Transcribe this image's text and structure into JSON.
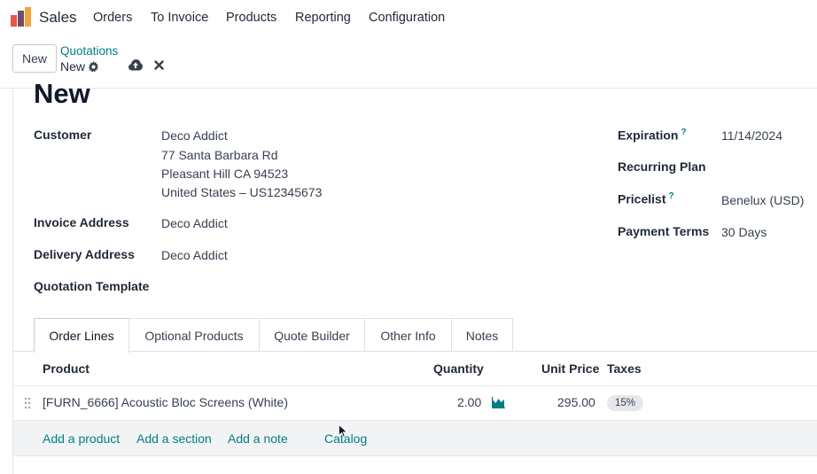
{
  "navbar": {
    "app_name": "Sales",
    "menu": [
      "Orders",
      "To Invoice",
      "Products",
      "Reporting",
      "Configuration"
    ]
  },
  "control_panel": {
    "new_button": "New",
    "breadcrumb_parent": "Quotations",
    "breadcrumb_current": "New"
  },
  "form": {
    "title": "New",
    "customer": {
      "label": "Customer",
      "name": "Deco Addict",
      "street": "77 Santa Barbara Rd",
      "city": "Pleasant Hill CA 94523",
      "country": "United States – US12345673"
    },
    "invoice_address": {
      "label": "Invoice Address",
      "value": "Deco Addict"
    },
    "delivery_address": {
      "label": "Delivery Address",
      "value": "Deco Addict"
    },
    "quotation_template": {
      "label": "Quotation Template",
      "value": ""
    },
    "expiration": {
      "label": "Expiration",
      "help": "?",
      "value": "11/14/2024"
    },
    "recurring_plan": {
      "label": "Recurring Plan",
      "value": ""
    },
    "pricelist": {
      "label": "Pricelist",
      "help": "?",
      "value": "Benelux (USD)"
    },
    "payment_terms": {
      "label": "Payment Terms",
      "value": "30 Days"
    }
  },
  "tabs": [
    "Order Lines",
    "Optional Products",
    "Quote Builder",
    "Other Info",
    "Notes"
  ],
  "active_tab": "Order Lines",
  "order_lines": {
    "columns": {
      "product": "Product",
      "quantity": "Quantity",
      "unit_price": "Unit Price",
      "taxes": "Taxes"
    },
    "rows": [
      {
        "product": "[FURN_6666] Acoustic Bloc Screens (White)",
        "quantity": "2.00",
        "unit_price": "295.00",
        "taxes": "15%"
      }
    ],
    "actions": {
      "add_product": "Add a product",
      "add_section": "Add a section",
      "add_note": "Add a note",
      "catalog": "Catalog"
    }
  },
  "colors": {
    "accent": "#017e84",
    "logo_orange": "#f2a33a",
    "logo_red": "#e4574c",
    "logo_purple": "#714b67"
  }
}
